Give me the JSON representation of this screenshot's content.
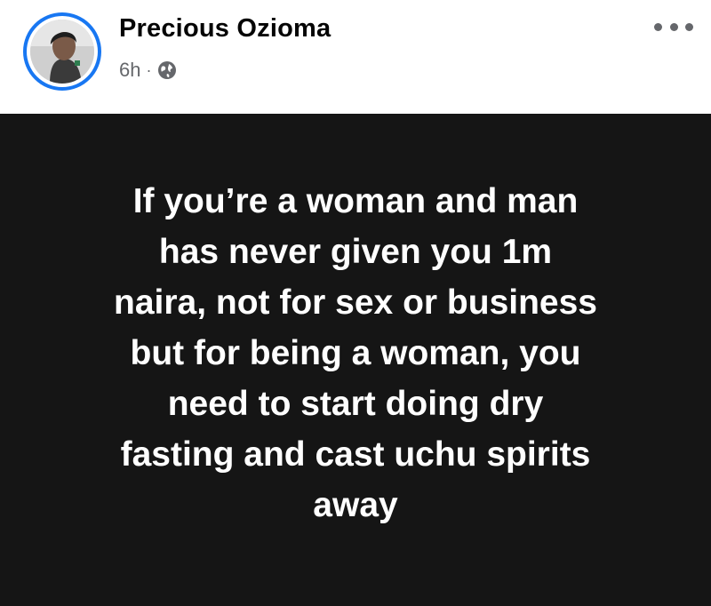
{
  "post": {
    "author": "Precious Ozioma",
    "time": "6h",
    "separator": "·",
    "privacy_icon": "globe-icon",
    "more_icon": "more-options-icon",
    "text": "If you’re a woman and man\nhas never given you 1m\nnaira, not for sex or business\nbut for being a woman, you\nneed to start doing dry\nfasting and cast uchu spirits\naway"
  },
  "colors": {
    "avatar_ring": "#1877f2",
    "post_background": "#151515",
    "post_text": "#ffffff",
    "author_text": "#050505",
    "meta_text": "#65676b"
  }
}
